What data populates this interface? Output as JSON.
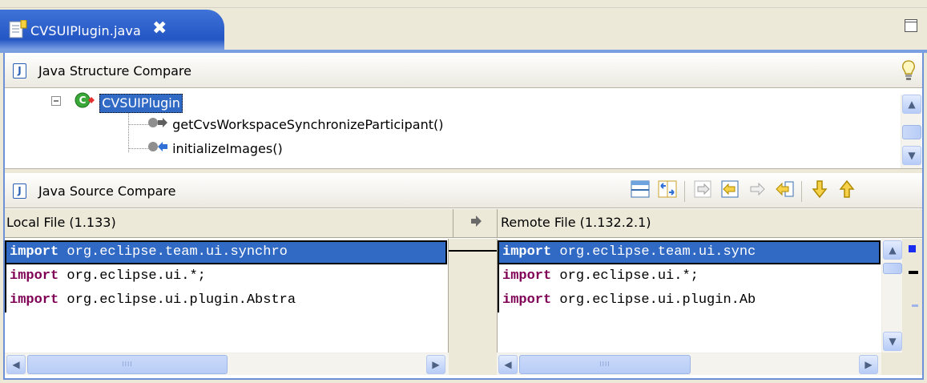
{
  "editor_tab": {
    "title": "CVSUIPlugin.java",
    "close_glyph": "✖"
  },
  "structure_pane": {
    "title": "Java Structure Compare",
    "tree": {
      "root": "CVSUIPlugin",
      "children": [
        "getCvsWorkspaceSynchronizeParticipant()",
        "initializeImages()"
      ]
    }
  },
  "source_pane": {
    "title": "Java Source Compare",
    "toolbar": [
      "horizontal-layout-icon",
      "swap-sides-icon",
      "copy-all-left-to-right-icon",
      "copy-all-nonconflicting-icon",
      "copy-current-left-to-right-icon",
      "copy-current-right-to-left-icon",
      "next-difference-icon",
      "previous-difference-icon"
    ],
    "left_header": "Local File (1.133)",
    "right_header": "Remote File (1.132.2.1)",
    "left_lines": [
      {
        "kw": "import",
        "rest": " org.eclipse.team.ui.synchro"
      },
      {
        "kw": "import",
        "rest": " org.eclipse.ui.*;"
      },
      {
        "kw": "import",
        "rest": " org.eclipse.ui.plugin.Abstra"
      }
    ],
    "right_lines": [
      {
        "kw": "import",
        "rest": " org.eclipse.team.ui.sync"
      },
      {
        "kw": "import",
        "rest": " org.eclipse.ui.*;"
      },
      {
        "kw": "import",
        "rest": " org.eclipse.ui.plugin.Ab"
      }
    ],
    "hscroll_grip": "IIII"
  },
  "colors": {
    "tab_active": "#2456c4",
    "selection": "#316ac5",
    "keyword": "#7f0055"
  }
}
